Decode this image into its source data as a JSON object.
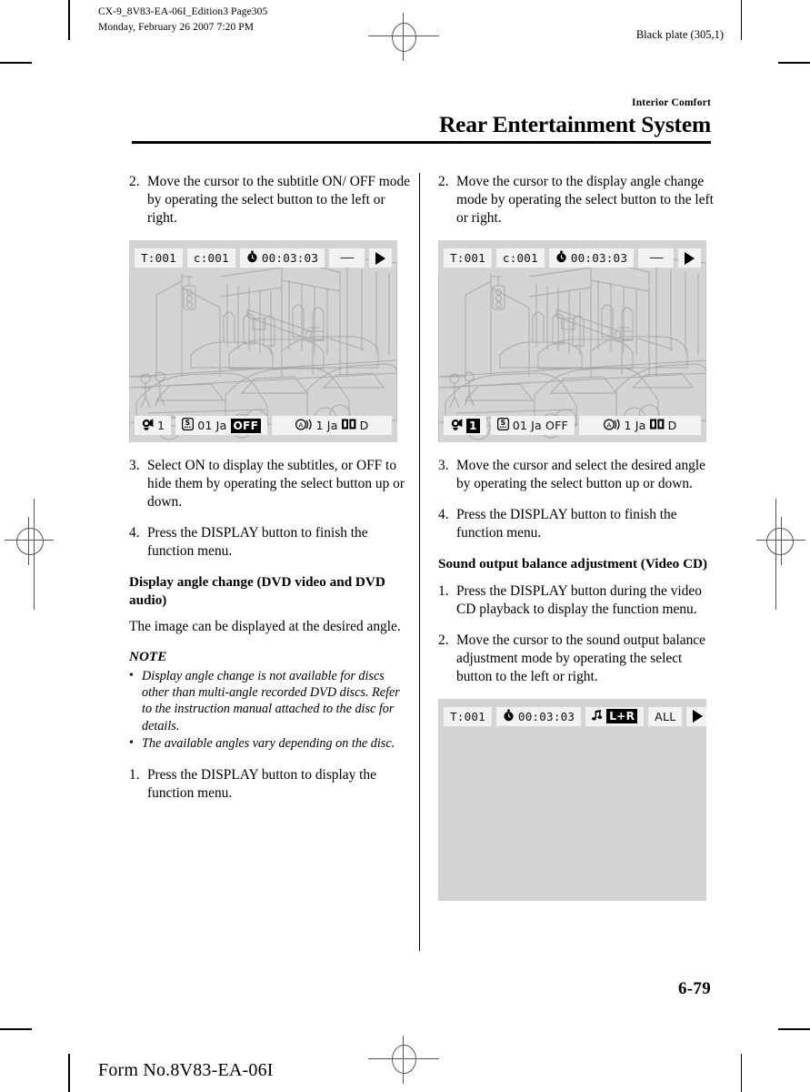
{
  "page_head": {
    "line1": "CX-9_8V83-EA-06I_Edition3 Page305",
    "line2": "Monday, February 26 2007 7:20 PM",
    "black_plate": "Black plate (305,1)"
  },
  "header": {
    "kicker": "Interior Comfort",
    "title": "Rear Entertainment System"
  },
  "left_column": {
    "step2": {
      "num": "2.",
      "text": "Move the cursor to the subtitle ON/ OFF mode by operating the select button to the left or right."
    },
    "screen": {
      "top": {
        "title": "T:001",
        "chapter": "c:001",
        "clock_icon": "stopwatch-icon",
        "time": "00:03:03",
        "dashes": "——",
        "play_icon": "play-icon"
      },
      "bottom": {
        "angle_icon": "camera-angle-icon",
        "angle_value": "1",
        "subtitle_icon": "subtitle-icon",
        "subtitle_num": "01",
        "subtitle_lang": "Ja",
        "subtitle_state": "OFF",
        "subtitle_state_highlighted": true,
        "audio_icon": "audio-icon",
        "audio_num": "1",
        "audio_lang": "Ja",
        "audio_format_icon": "dolby-icon",
        "audio_format": "D"
      }
    },
    "step3": {
      "num": "3.",
      "text": "Select ON to display the subtitles, or OFF to hide them by operating the select button up or down."
    },
    "step4": {
      "num": "4.",
      "text": "Press the DISPLAY button to finish the function menu."
    },
    "subhead": "Display angle change (DVD video and DVD audio)",
    "para": "The image can be displayed at the desired angle.",
    "note_label": "NOTE",
    "notes": [
      "Display angle change is not available for discs other than multi-angle recorded DVD discs. Refer to the instruction manual attached to the disc for details.",
      "The available angles vary depending on the disc."
    ],
    "step1b": {
      "num": "1.",
      "text": "Press the DISPLAY button to display the function menu."
    }
  },
  "right_column": {
    "step2": {
      "num": "2.",
      "text": "Move the cursor to the display angle change mode by operating the select button to the left or right."
    },
    "screen": {
      "top": {
        "title": "T:001",
        "chapter": "c:001",
        "clock_icon": "stopwatch-icon",
        "time": "00:03:03",
        "dashes": "——",
        "play_icon": "play-icon"
      },
      "bottom": {
        "angle_icon": "camera-angle-icon",
        "angle_value": "1",
        "angle_value_highlighted": true,
        "subtitle_icon": "subtitle-icon",
        "subtitle_num": "01",
        "subtitle_lang": "Ja",
        "subtitle_state": "OFF",
        "audio_icon": "audio-icon",
        "audio_num": "1",
        "audio_lang": "Ja",
        "audio_format_icon": "dolby-icon",
        "audio_format": "D"
      }
    },
    "step3": {
      "num": "3.",
      "text": "Move the cursor and select the desired angle by operating the select button up or down."
    },
    "step4": {
      "num": "4.",
      "text": "Press the DISPLAY button to finish the function menu."
    },
    "subhead": "Sound output balance adjustment (Video CD)",
    "step1": {
      "num": "1.",
      "text": "Press the DISPLAY button during the video CD playback to display the function menu."
    },
    "step2b": {
      "num": "2.",
      "text": "Move the cursor to the sound output balance adjustment mode by operating the select button to the left or right."
    },
    "screen2": {
      "top": {
        "title": "T:001",
        "clock_icon": "stopwatch-icon",
        "time": "00:03:03",
        "note_icon": "music-note-icon",
        "balance": "L+R",
        "balance_highlighted": true,
        "repeat": "ALL",
        "play_icon": "play-icon"
      }
    }
  },
  "footer": {
    "page_number": "6-79",
    "form_no": "Form No.8V83-EA-06I"
  }
}
